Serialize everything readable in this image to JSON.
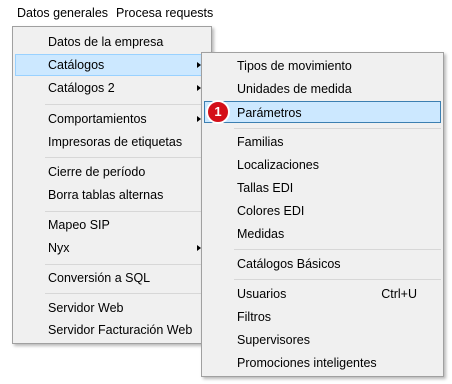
{
  "menubar": {
    "items": [
      "Datos generales",
      "Procesa requests"
    ]
  },
  "main_menu": {
    "items": [
      "Datos de la empresa",
      "Catálogos",
      "Catálogos 2",
      "Comportamientos",
      "Impresoras de etiquetas",
      "Cierre de período",
      "Borra tablas alternas",
      "Mapeo SIP",
      "Nyx",
      "Conversión a SQL",
      "Servidor Web",
      "Servidor Facturación Web"
    ],
    "highlighted": "Catálogos",
    "submenu_arrows": [
      "Catálogos",
      "Catálogos 2",
      "Comportamientos",
      "Nyx"
    ]
  },
  "sub_menu": {
    "items": [
      "Tipos de movimiento",
      "Unidades de medida",
      "Parámetros",
      "Familias",
      "Localizaciones",
      "Tallas EDI",
      "Colores EDI",
      "Medidas",
      "Catálogos Básicos",
      "Usuarios",
      "Filtros",
      "Supervisores",
      "Promociones inteligentes"
    ],
    "shortcuts": {
      "Usuarios": "Ctrl+U"
    },
    "selected": "Parámetros"
  },
  "callout": {
    "number": "1",
    "color": "#d4101a"
  },
  "colors": {
    "menu_bg": "#f0f0f0",
    "highlight": "#cce8ff",
    "selection_border": "#3c7fb1"
  }
}
